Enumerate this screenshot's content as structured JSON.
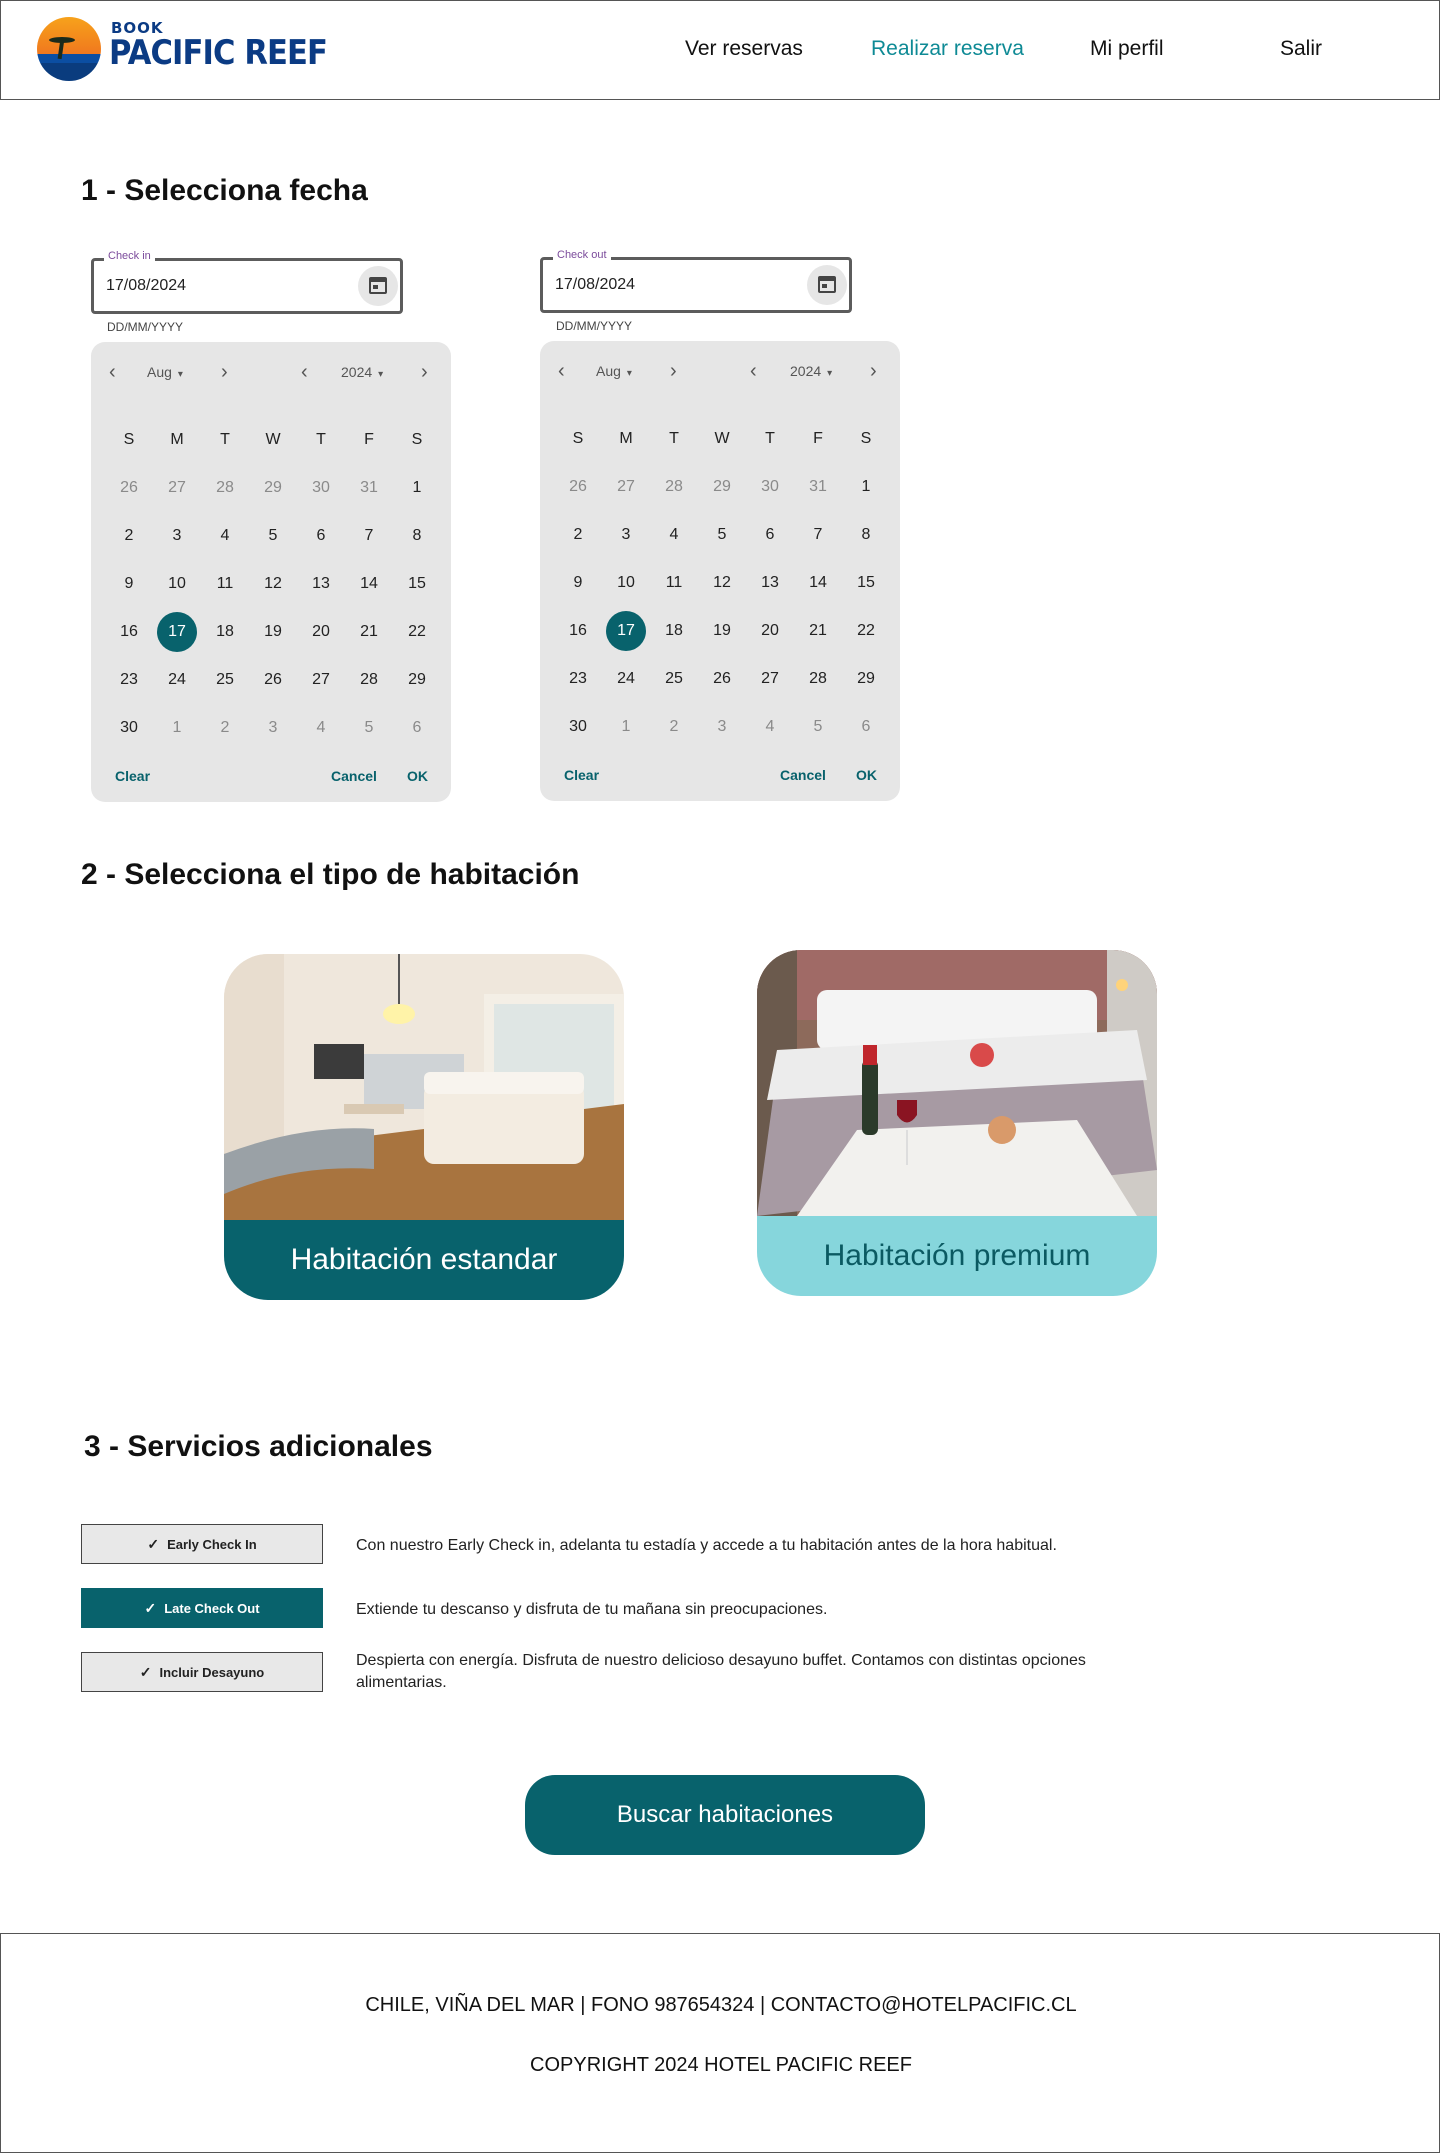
{
  "header": {
    "logo": {
      "book": "BOOK",
      "name": "PACIFIC REEF"
    },
    "nav": [
      {
        "label": "Ver reservas",
        "active": false
      },
      {
        "label": "Realizar reserva",
        "active": true
      },
      {
        "label": "Mi perfil",
        "active": false
      },
      {
        "label": "Salir",
        "active": false
      }
    ]
  },
  "step1": {
    "title": "1 - Selecciona fecha",
    "checkin": {
      "label": "Check in",
      "value": "17/08/2024",
      "hint": "DD/MM/YYYY",
      "month": "Aug",
      "year": "2024",
      "weekdays": [
        "S",
        "M",
        "T",
        "W",
        "T",
        "F",
        "S"
      ],
      "days": [
        "26",
        "27",
        "28",
        "29",
        "30",
        "31",
        "1",
        "2",
        "3",
        "4",
        "5",
        "6",
        "7",
        "8",
        "9",
        "10",
        "11",
        "12",
        "13",
        "14",
        "15",
        "16",
        "17",
        "18",
        "19",
        "20",
        "21",
        "22",
        "23",
        "24",
        "25",
        "26",
        "27",
        "28",
        "29",
        "30",
        "1",
        "2",
        "3",
        "4",
        "5",
        "6"
      ],
      "selected": "17",
      "actions": {
        "clear": "Clear",
        "cancel": "Cancel",
        "ok": "OK"
      }
    },
    "checkout": {
      "label": "Check out",
      "value": "17/08/2024",
      "hint": "DD/MM/YYYY",
      "month": "Aug",
      "year": "2024",
      "weekdays": [
        "S",
        "M",
        "T",
        "W",
        "T",
        "F",
        "S"
      ],
      "days": [
        "26",
        "27",
        "28",
        "29",
        "30",
        "31",
        "1",
        "2",
        "3",
        "4",
        "5",
        "6",
        "7",
        "8",
        "9",
        "10",
        "11",
        "12",
        "13",
        "14",
        "15",
        "16",
        "17",
        "18",
        "19",
        "20",
        "21",
        "22",
        "23",
        "24",
        "25",
        "26",
        "27",
        "28",
        "29",
        "30",
        "1",
        "2",
        "3",
        "4",
        "5",
        "6"
      ],
      "selected": "17",
      "actions": {
        "clear": "Clear",
        "cancel": "Cancel",
        "ok": "OK"
      }
    }
  },
  "step2": {
    "title": "2 - Selecciona el tipo de habitación",
    "rooms": [
      {
        "label": "Habitación estandar"
      },
      {
        "label": "Habitación premium"
      }
    ]
  },
  "step3": {
    "title": "3 - Servicios adicionales",
    "services": [
      {
        "label": "Early Check In",
        "selected": false,
        "description": "Con nuestro Early Check in, adelanta tu estadía y accede a tu habitación antes de la hora habitual."
      },
      {
        "label": "Late Check Out",
        "selected": true,
        "description": "Extiende tu descanso y disfruta de tu mañana sin preocupaciones."
      },
      {
        "label": "Incluir Desayuno",
        "selected": false,
        "description": "Despierta con energía. Disfruta de nuestro delicioso desayuno buffet. Contamos con distintas opciones alimentarias."
      }
    ]
  },
  "search_button": "Buscar habitaciones",
  "footer": {
    "contact": "CHILE, VIÑA DEL MAR | FONO 987654324 | CONTACTO@HOTELPACIFIC.CL",
    "copyright": "COPYRIGHT 2024 HOTEL PACIFIC REEF"
  },
  "colors": {
    "primary": "#08626C",
    "accent_link": "#0E8A95",
    "premium": "#86D6DC"
  }
}
